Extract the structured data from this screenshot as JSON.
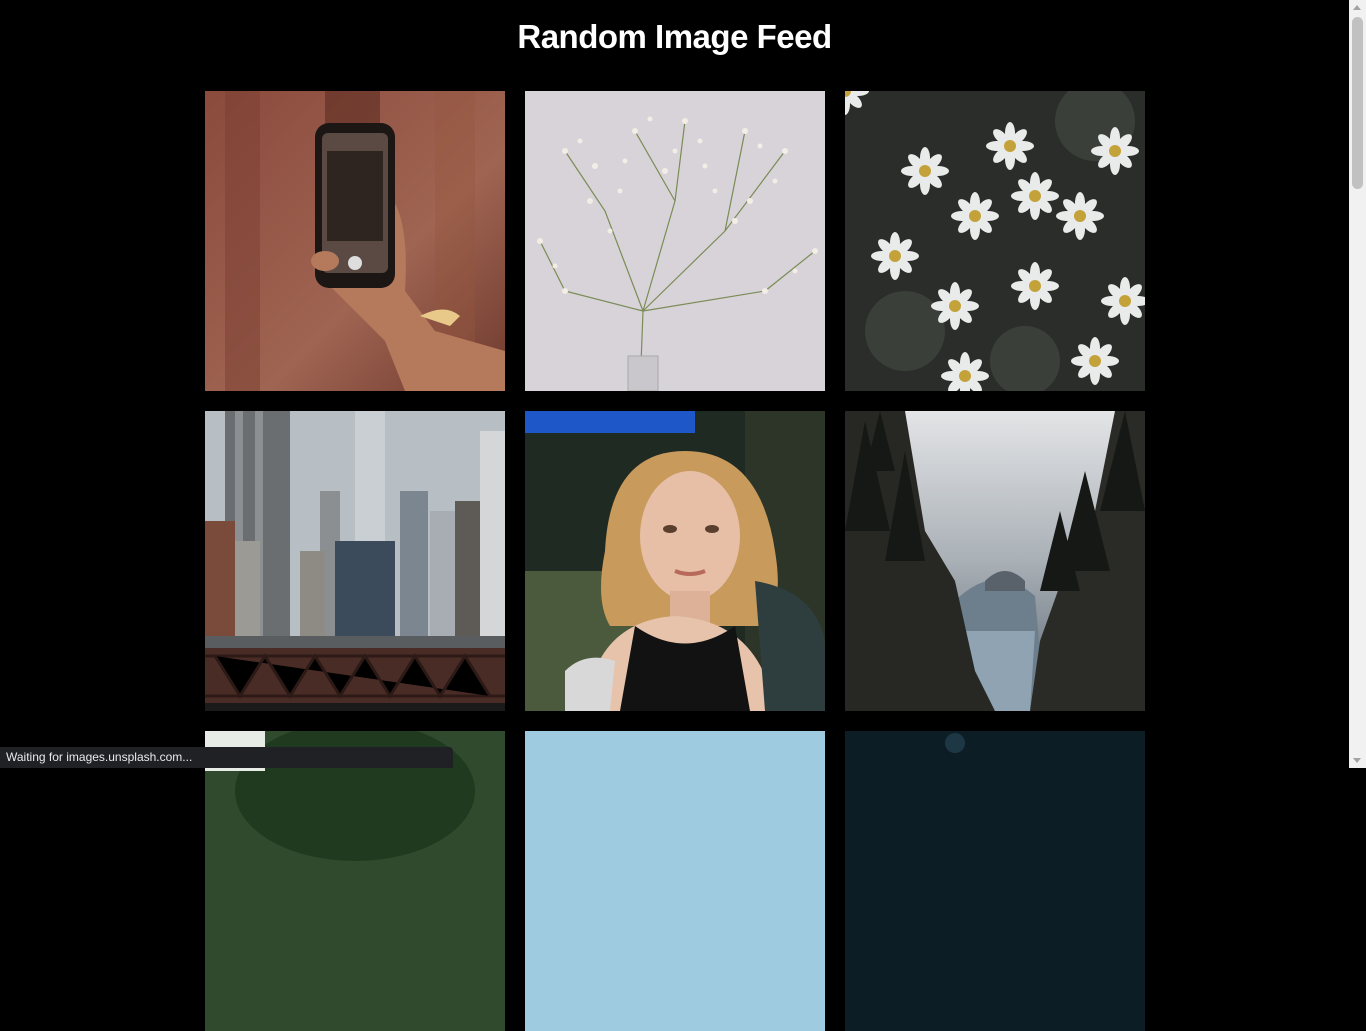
{
  "page": {
    "title": "Random Image Feed"
  },
  "feed": {
    "images": [
      {
        "subject": "hand-holding-phone-photo"
      },
      {
        "subject": "babys-breath-flowers-photo"
      },
      {
        "subject": "white-daisies-photo"
      },
      {
        "subject": "city-skyline-bridge-photo"
      },
      {
        "subject": "woman-portrait-photo"
      },
      {
        "subject": "forest-cliffs-river-photo"
      },
      {
        "subject": "partial-image-green"
      },
      {
        "subject": "partial-image-sky"
      },
      {
        "subject": "partial-image-dark-teal"
      }
    ]
  },
  "browser": {
    "status_text": "Waiting for images.unsplash.com..."
  }
}
